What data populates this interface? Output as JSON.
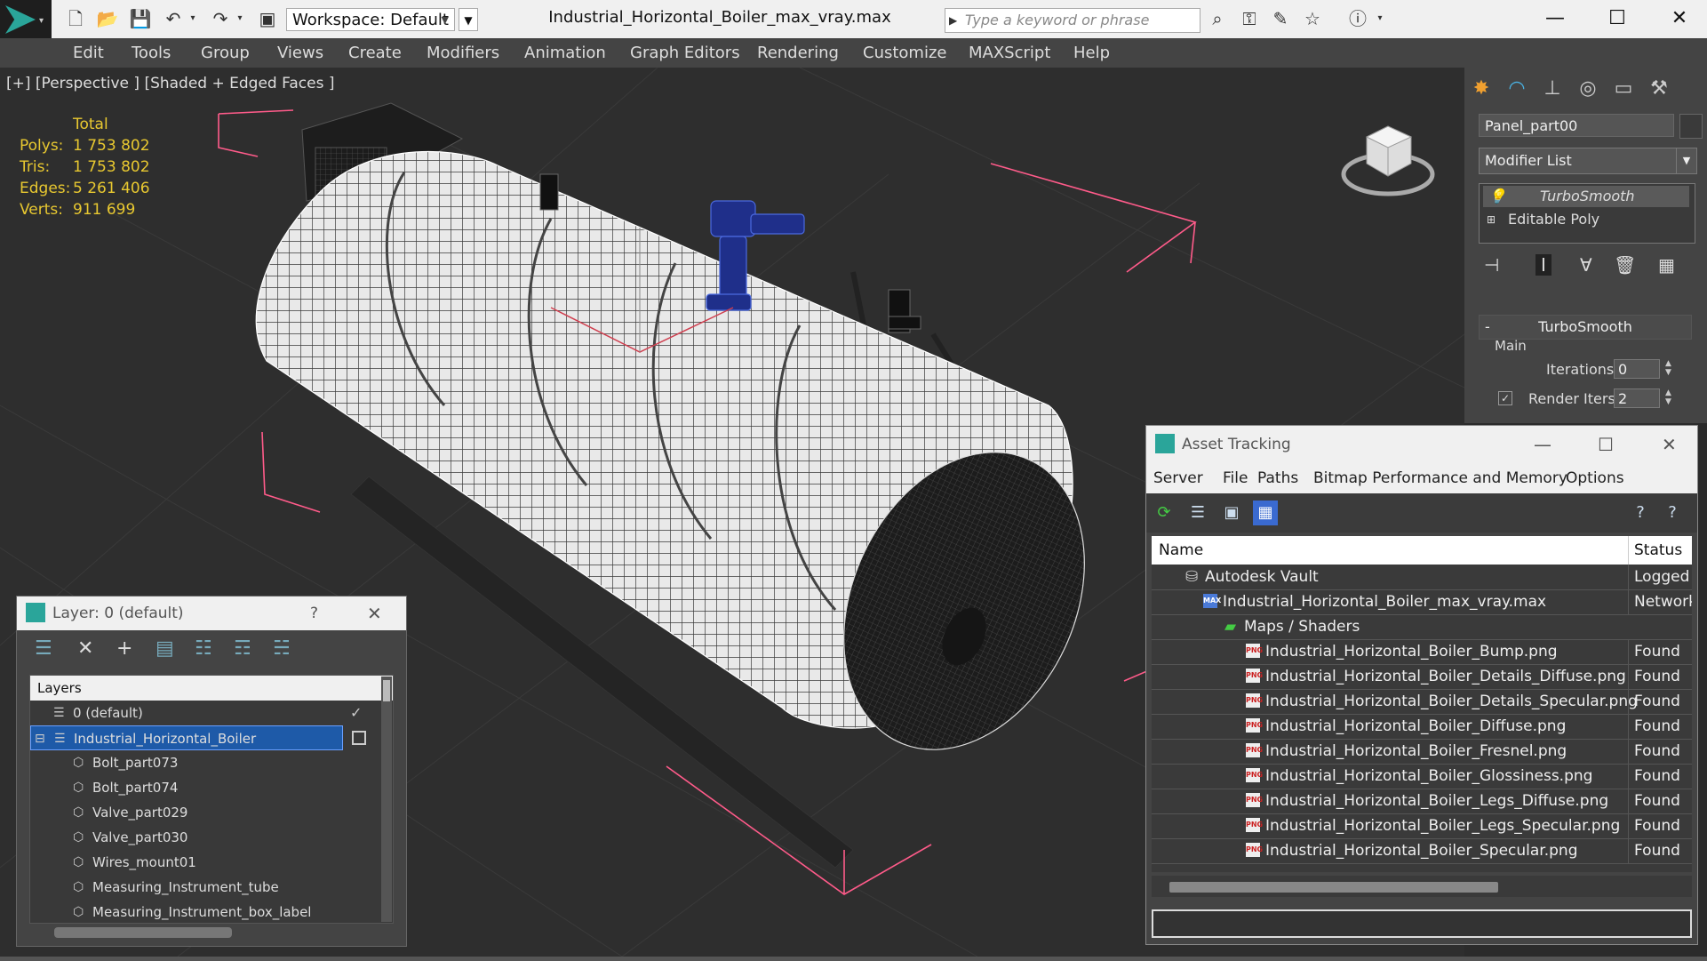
{
  "titlebar": {
    "workspace_label": "Workspace: Default",
    "document_title": "Industrial_Horizontal_Boiler_max_vray.max",
    "search_placeholder": "Type a keyword or phrase"
  },
  "menubar": {
    "items": [
      "Edit",
      "Tools",
      "Group",
      "Views",
      "Create",
      "Modifiers",
      "Animation",
      "Graph Editors",
      "Rendering",
      "Customize",
      "MAXScript",
      "Help"
    ]
  },
  "viewport": {
    "label": "[+] [Perspective ] [Shaded + Edged Faces ]",
    "stats": {
      "header": "Total",
      "polys_label": "Polys:",
      "polys": "1 753 802",
      "tris_label": "Tris:",
      "tris": "1 753 802",
      "edges_label": "Edges:",
      "edges": "5 261 406",
      "verts_label": "Verts:",
      "verts": "911 699"
    }
  },
  "command_panel": {
    "object_name": "Panel_part00",
    "modifier_list": "Modifier List",
    "stack": [
      "TurboSmooth",
      "Editable Poly"
    ],
    "rollout_title": "TurboSmooth",
    "group_main": "Main",
    "iterations_label": "Iterations:",
    "iterations_value": "0",
    "render_iters_label": "Render Iters:",
    "render_iters_value": "2"
  },
  "layer_window": {
    "title": "Layer: 0 (default)",
    "help": "?",
    "column_header": "Layers",
    "rows": [
      {
        "name": "0 (default)"
      },
      {
        "name": "Industrial_Horizontal_Boiler"
      },
      {
        "name": "Bolt_part073"
      },
      {
        "name": "Bolt_part074"
      },
      {
        "name": "Valve_part029"
      },
      {
        "name": "Valve_part030"
      },
      {
        "name": "Wires_mount01"
      },
      {
        "name": "Measuring_Instrument_tube"
      },
      {
        "name": "Measuring_Instrument_box_label"
      }
    ]
  },
  "asset_tracking": {
    "title": "Asset Tracking",
    "menu": [
      "Server",
      "File",
      "Paths",
      "Bitmap Performance and Memory",
      "Options"
    ],
    "columns": {
      "name": "Name",
      "status": "Status"
    },
    "rows": [
      {
        "name": "Autodesk Vault",
        "status": "Logged Out"
      },
      {
        "name": "Industrial_Horizontal_Boiler_max_vray.max",
        "status": "Network Path"
      },
      {
        "name": "Maps / Shaders",
        "status": ""
      },
      {
        "name": "Industrial_Horizontal_Boiler_Bump.png",
        "status": "Found"
      },
      {
        "name": "Industrial_Horizontal_Boiler_Details_Diffuse.png",
        "status": "Found"
      },
      {
        "name": "Industrial_Horizontal_Boiler_Details_Specular.png",
        "status": "Found"
      },
      {
        "name": "Industrial_Horizontal_Boiler_Diffuse.png",
        "status": "Found"
      },
      {
        "name": "Industrial_Horizontal_Boiler_Fresnel.png",
        "status": "Found"
      },
      {
        "name": "Industrial_Horizontal_Boiler_Glossiness.png",
        "status": "Found"
      },
      {
        "name": "Industrial_Horizontal_Boiler_Legs_Diffuse.png",
        "status": "Found"
      },
      {
        "name": "Industrial_Horizontal_Boiler_Legs_Specular.png",
        "status": "Found"
      },
      {
        "name": "Industrial_Horizontal_Boiler_Specular.png",
        "status": "Found"
      }
    ],
    "png_badge": "PNG",
    "max_badge": "MAX"
  },
  "colors": {
    "stats_text": "#e8c830",
    "selected_row": "#1e5aa8",
    "bounding_box": "#ff5b8a",
    "accent_teal": "#2aa59a"
  }
}
